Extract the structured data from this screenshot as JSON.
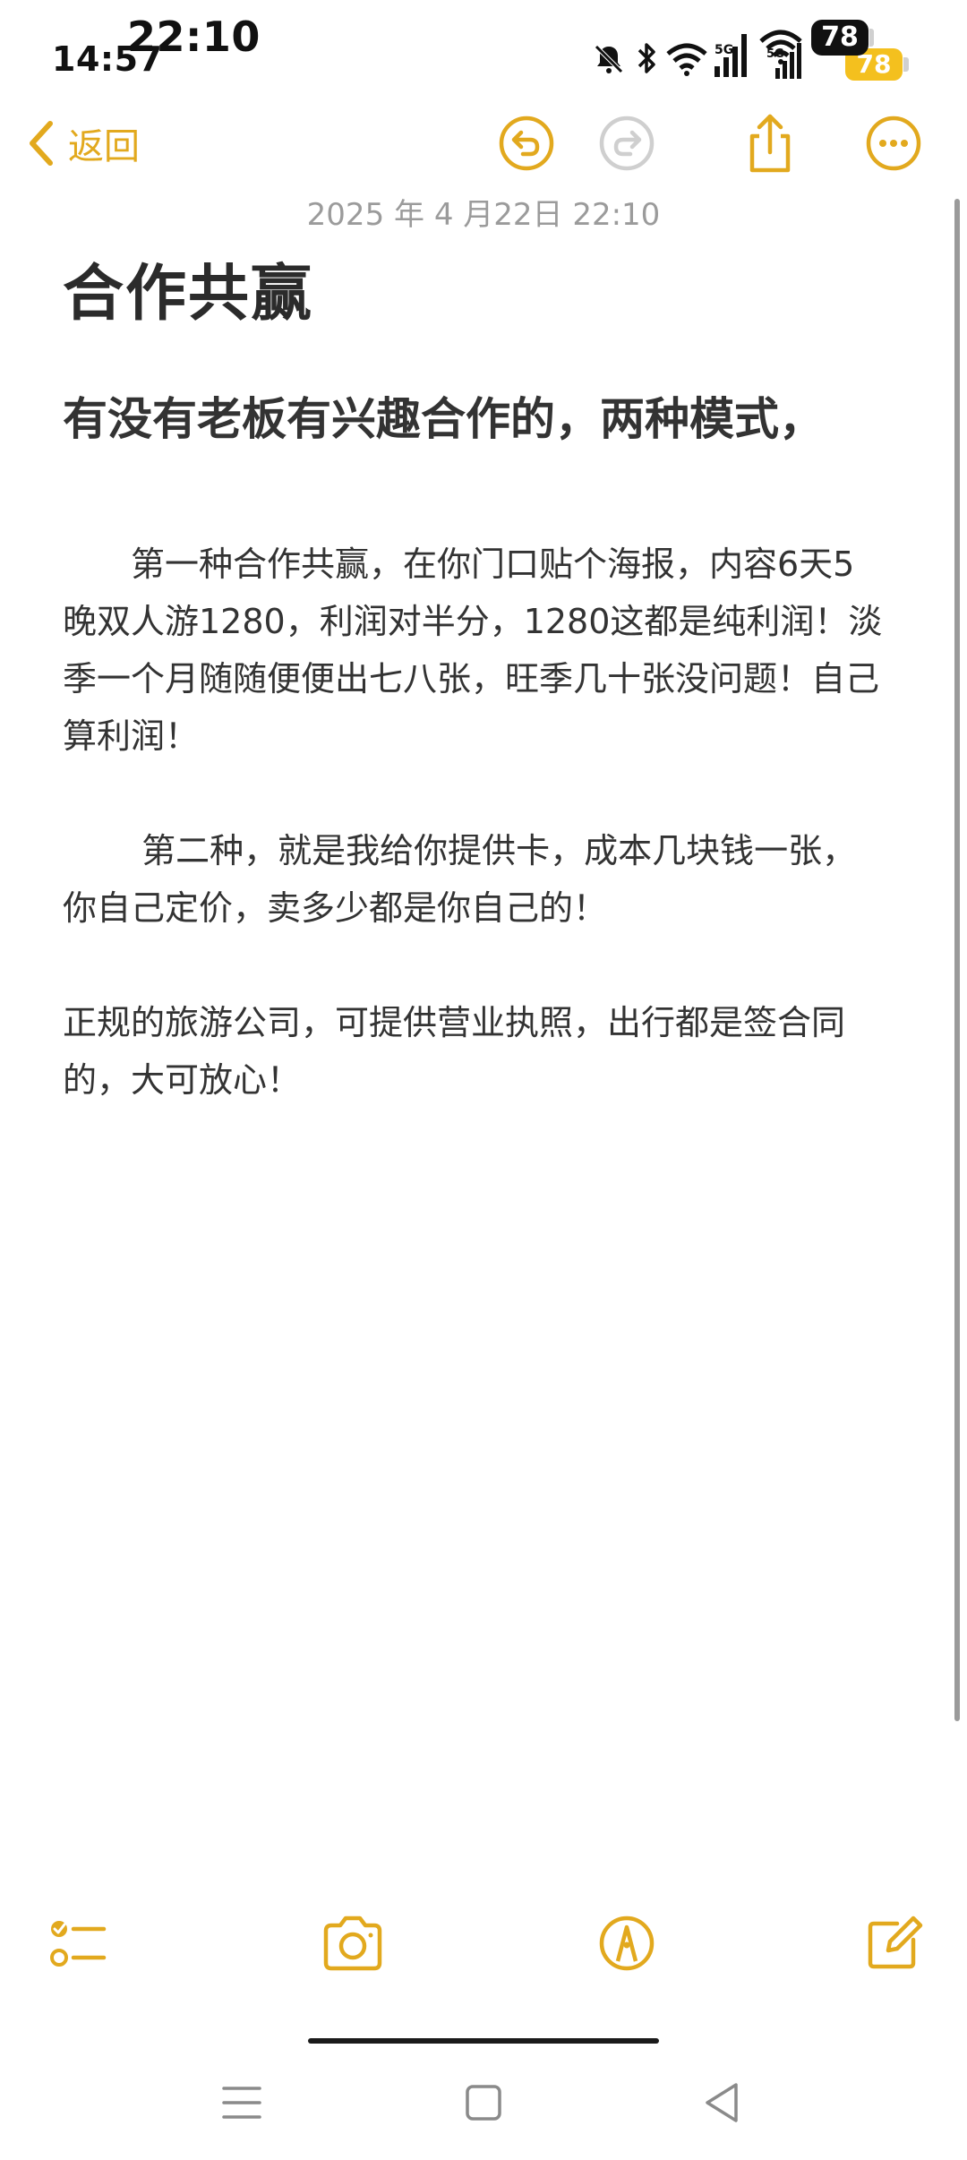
{
  "status_bar": {
    "time_back": "14:57",
    "time_front": "22:10",
    "battery_front": "78",
    "battery_back": "78",
    "icons": [
      "mute-bell-icon",
      "bluetooth-icon",
      "wifi-icon",
      "signal-5g-icon",
      "wifi-icon",
      "signal-5g-icon",
      "battery-icon"
    ],
    "network_label_1": "5G",
    "network_label_2": "5G"
  },
  "nav": {
    "back_label": "返回",
    "icons": [
      "undo-icon",
      "redo-icon",
      "share-icon",
      "more-icon"
    ]
  },
  "note": {
    "date": "2025 年 4 月22日 22:10",
    "title": "合作共赢",
    "heading": "有没有老板有兴趣合作的，两种模式，",
    "paragraphs": [
      "　　第一种合作共赢，在你门口贴个海报，内容6天5晚双人游1280，利润对半分，1280这都是纯利润！淡季一个月随随便便出七八张，旺季几十张没问题！自己算利润！",
      "　　 第二种，就是我给你提供卡，成本几块钱一张，你自己定价，卖多少都是你自己的！",
      "正规的旅游公司，可提供营业执照，出行都是签合同的，大可放心！"
    ]
  },
  "toolbar": {
    "icons": [
      "checklist-icon",
      "camera-icon",
      "markup-pen-icon",
      "compose-icon"
    ]
  },
  "colors": {
    "accent": "#e2a91e",
    "text": "#333333",
    "date": "#9b9b9b",
    "battery": "#f4c01e"
  }
}
